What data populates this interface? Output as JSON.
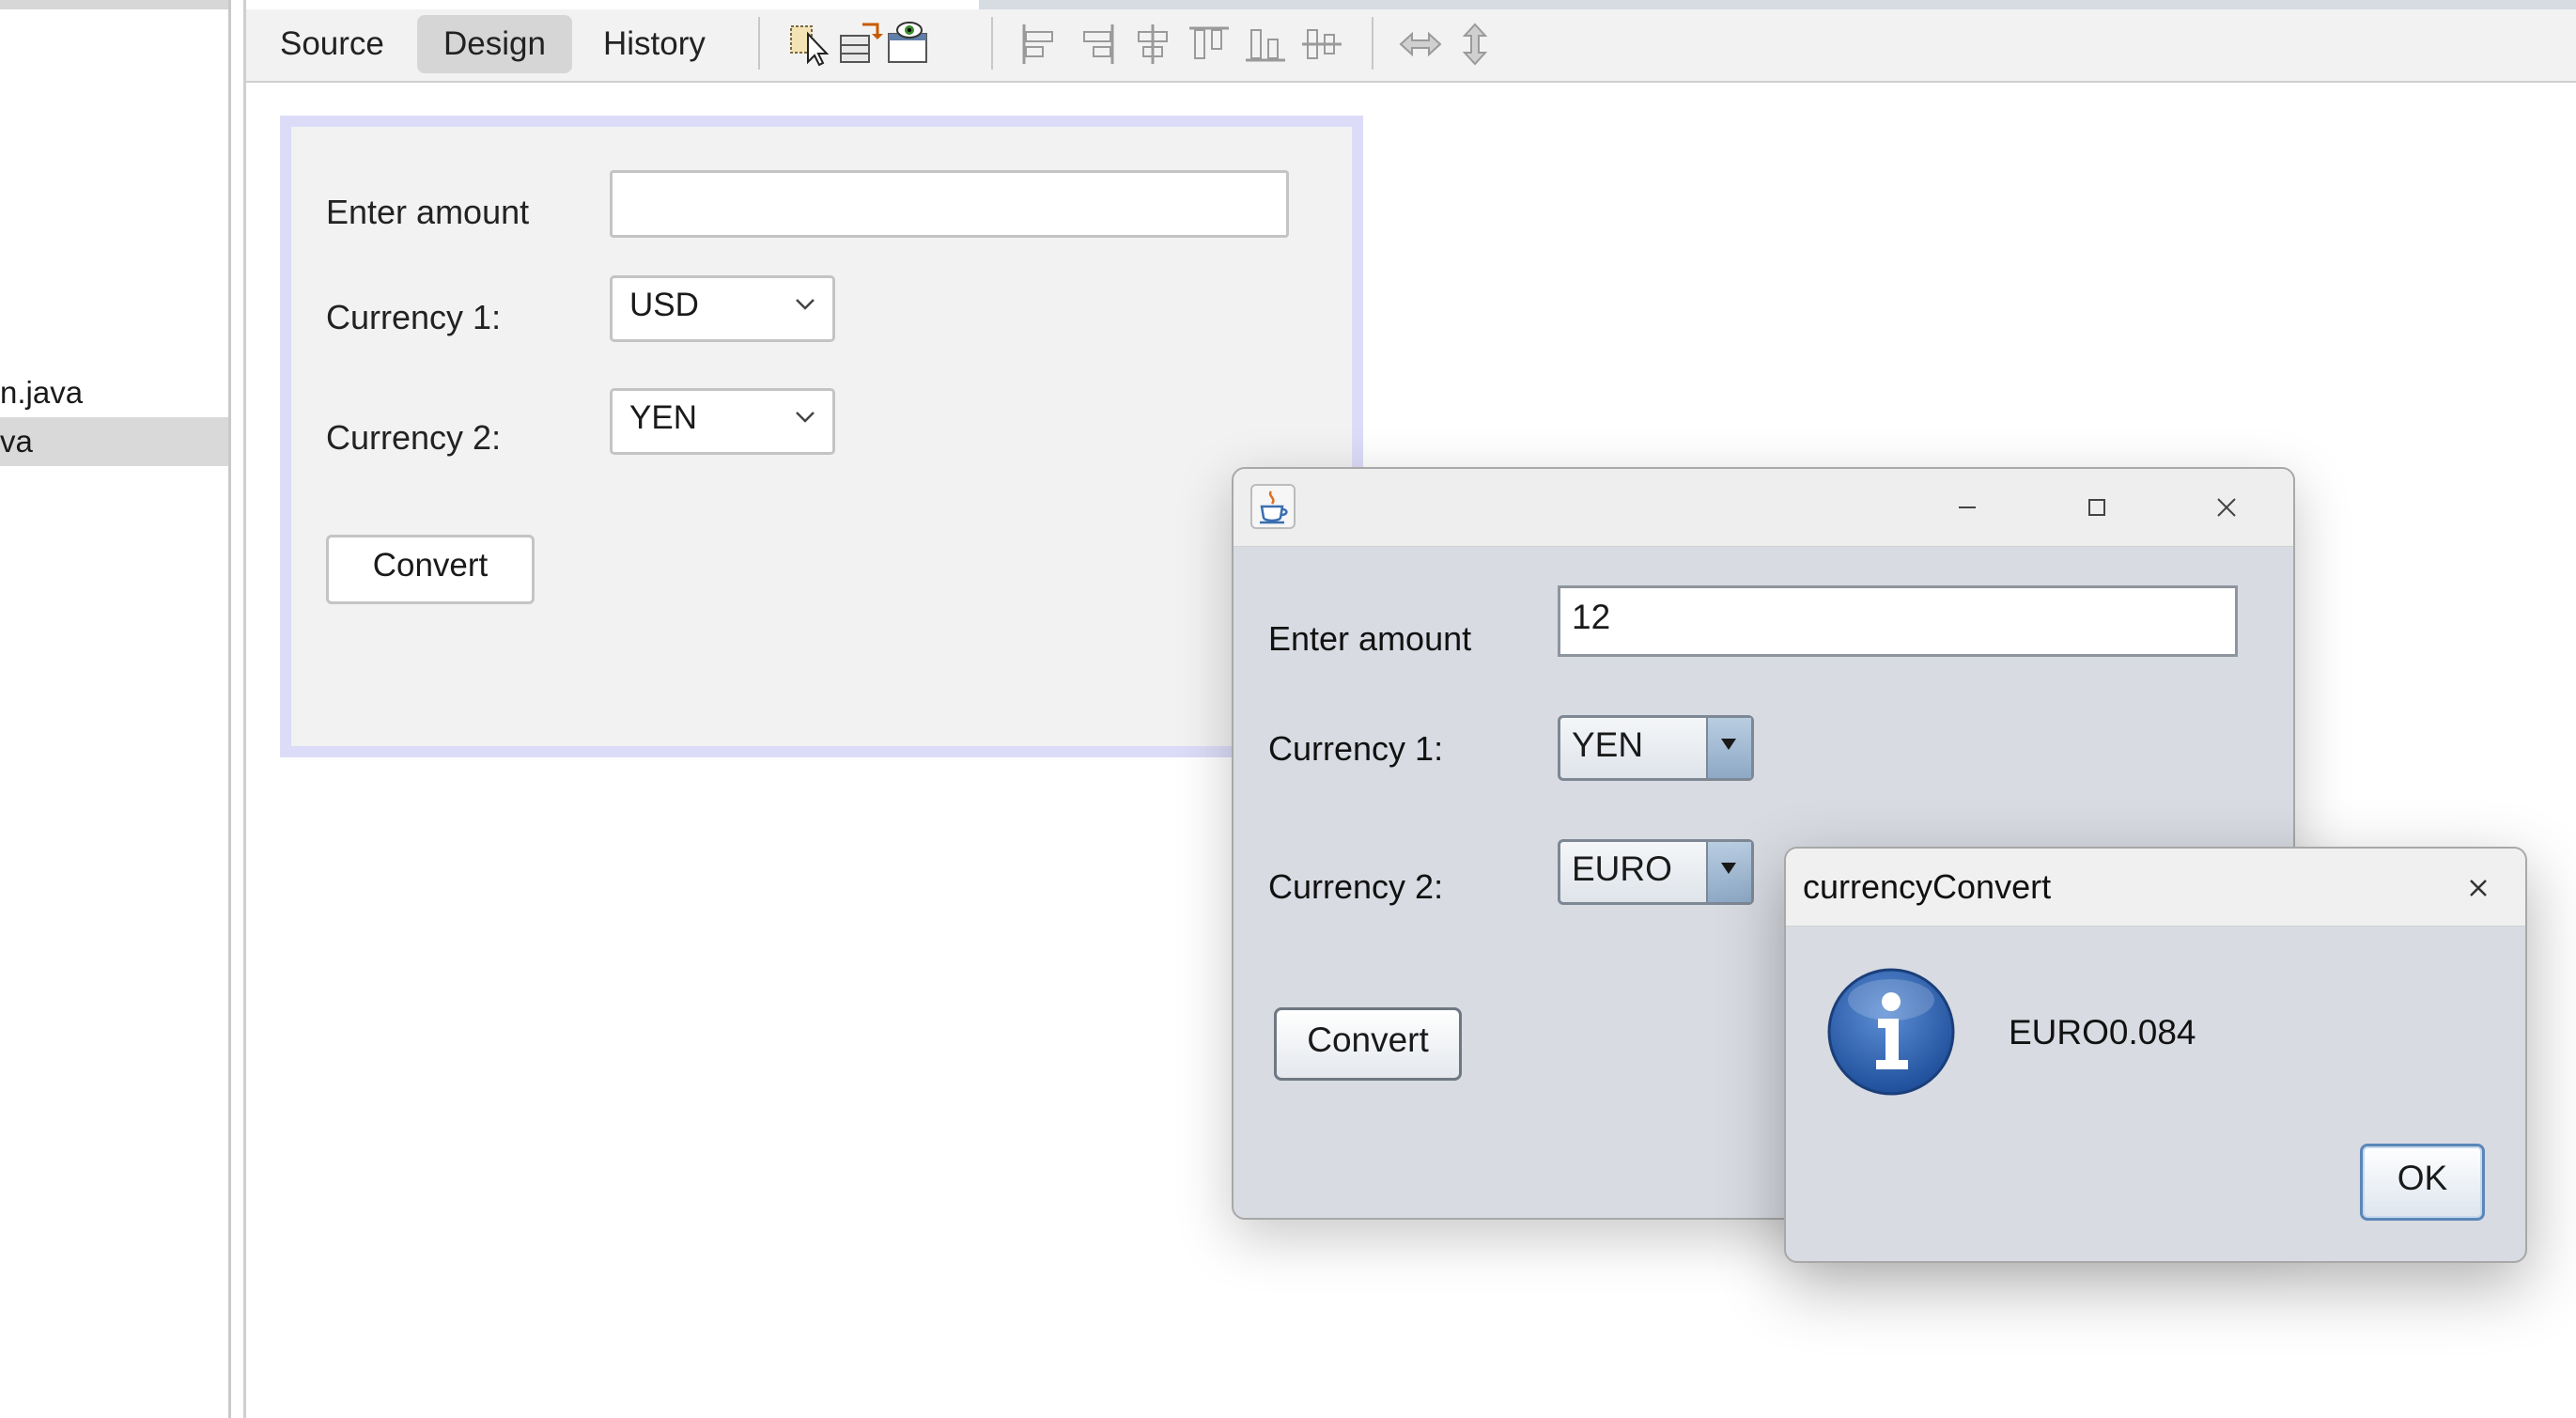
{
  "project_tree": {
    "items": [
      {
        "label": "n.java"
      },
      {
        "label": "va"
      }
    ]
  },
  "editor_toolbar": {
    "tabs": [
      {
        "label": "Source"
      },
      {
        "label": "Design"
      },
      {
        "label": "History"
      }
    ],
    "active_tab": "Design",
    "icons": [
      "selection-mode-icon",
      "connection-mode-icon",
      "preview-design-icon",
      "align-left-icon",
      "align-right-icon",
      "center-horizontally-icon",
      "align-top-icon",
      "align-bottom-icon",
      "center-vertically-icon",
      "change-horizontal-resizability-icon",
      "change-vertical-resizability-icon"
    ]
  },
  "design_form": {
    "amount_label": "Enter amount",
    "amount_value": "",
    "currency1_label": "Currency 1:",
    "currency1_value": "USD",
    "currency2_label": "Currency 2:",
    "currency2_value": "YEN",
    "convert_label": "Convert"
  },
  "runtime_window": {
    "title": "",
    "amount_label": "Enter amount",
    "amount_value": "12",
    "currency1_label": "Currency 1:",
    "currency1_value": "YEN",
    "currency2_label": "Currency 2:",
    "currency2_value": "EURO",
    "convert_label": "Convert"
  },
  "message_dialog": {
    "title": "currencyConvert",
    "message": "EURO0.084",
    "ok_label": "OK"
  },
  "colors": {
    "design_form_border": "#dcdcf8",
    "swing_background": "#d8dbe2",
    "info_icon_blue": "#2a5fa8",
    "ok_button_border": "#5b87b8"
  }
}
